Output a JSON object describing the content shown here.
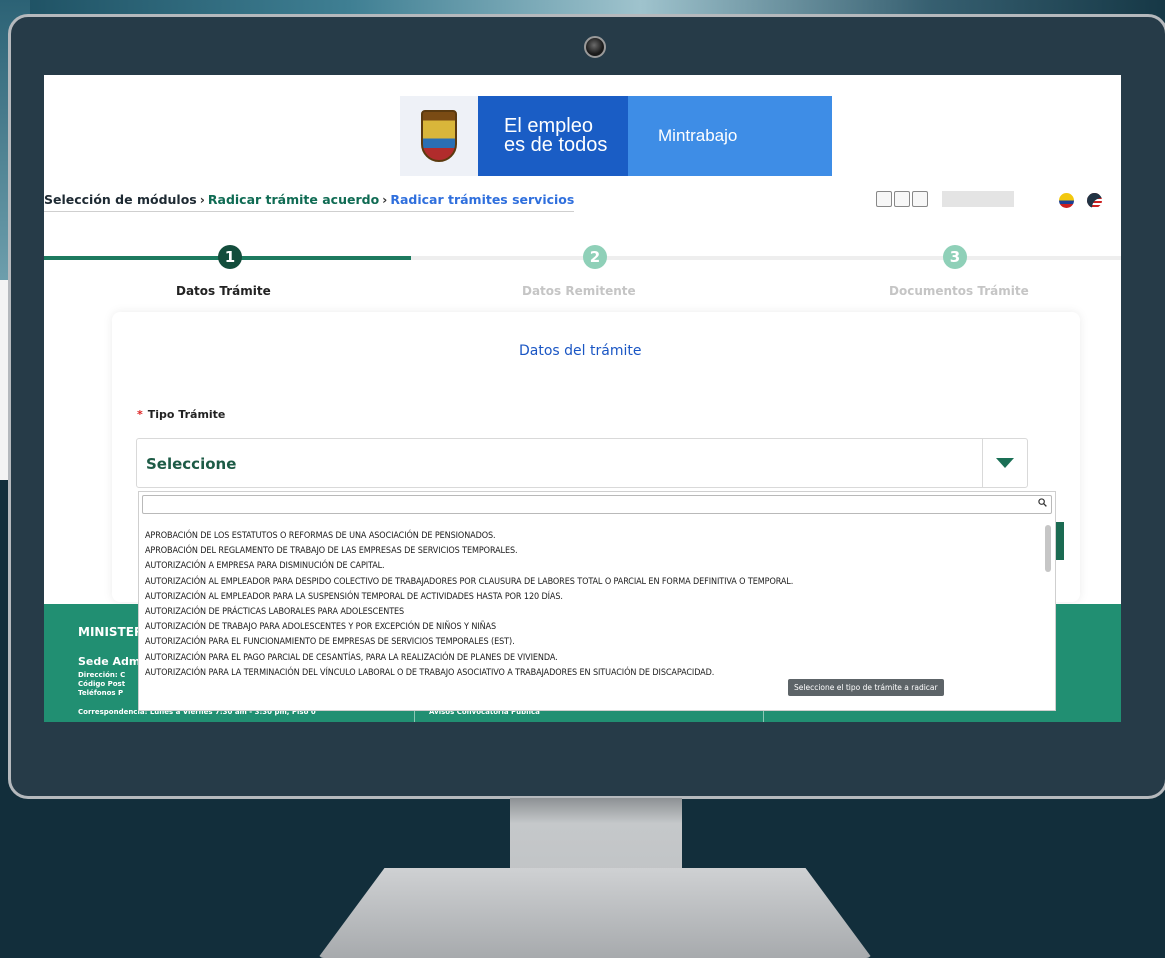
{
  "header": {
    "slogan_line1": "El empleo",
    "slogan_line2": "es de todos",
    "brand": "Mintrabajo"
  },
  "breadcrumb": {
    "item1": "Selección de módulos",
    "item2": "Radicar trámite acuerdo",
    "item3": "Radicar trámites servicios",
    "separator": "›"
  },
  "stepper": {
    "steps": [
      {
        "number": "1",
        "label": "Datos Trámite",
        "state": "active"
      },
      {
        "number": "2",
        "label": "Datos Remitente",
        "state": "pending"
      },
      {
        "number": "3",
        "label": "Documentos Trámite",
        "state": "pending"
      }
    ]
  },
  "form": {
    "title": "Datos del trámite",
    "required_mark": "*",
    "field_label": "Tipo Trámite",
    "select_value": "Seleccione",
    "search_value": ""
  },
  "dropdown": {
    "options": [
      "APROBACIÓN DE LOS ESTATUTOS O REFORMAS DE UNA ASOCIACIÓN DE PENSIONADOS.",
      "APROBACIÓN DEL REGLAMENTO DE TRABAJO DE LAS EMPRESAS DE SERVICIOS TEMPORALES.",
      "AUTORIZACIÓN A EMPRESA PARA DISMINUCIÓN DE CAPITAL.",
      "AUTORIZACIÓN AL EMPLEADOR PARA DESPIDO COLECTIVO DE TRABAJADORES POR CLAUSURA DE LABORES TOTAL O PARCIAL EN FORMA DEFINITIVA O TEMPORAL.",
      "AUTORIZACIÓN AL EMPLEADOR PARA LA SUSPENSIÓN TEMPORAL DE ACTIVIDADES HASTA POR 120 DÍAS.",
      "AUTORIZACIÓN DE PRÁCTICAS LABORALES PARA ADOLESCENTES",
      "AUTORIZACIÓN DE TRABAJO PARA ADOLESCENTES Y POR EXCEPCIÓN DE NIÑOS Y NIÑAS",
      "AUTORIZACIÓN PARA EL FUNCIONAMIENTO DE EMPRESAS DE SERVICIOS TEMPORALES (EST).",
      "AUTORIZACIÓN PARA EL PAGO PARCIAL DE CESANTÍAS, PARA LA REALIZACIÓN DE PLANES DE VIVIENDA.",
      "AUTORIZACIÓN PARA LA TERMINACIÓN DEL VÍNCULO LABORAL O DE TRABAJO ASOCIATIVO A TRABAJADORES EN SITUACIÓN DE DISCAPACIDAD."
    ]
  },
  "tooltip": "Seleccione el tipo de trámite a radicar",
  "footer": {
    "ministry": "MINISTER",
    "sede": "Sede Adm",
    "lines": [
      "Dirección: C",
      "Código Post",
      "Teléfonos P",
      "Correspondencia: Lunes a Viernes 7:30 am - 3:30 pm, Piso 0"
    ],
    "right_text": "Avisos Convocatoria Pública"
  },
  "colors": {
    "primary_green": "#1d7a5f",
    "link_blue": "#2f6fdd",
    "banner_dark_blue": "#1a5dc5",
    "banner_light_blue": "#3e8de6",
    "footer_green": "#218f72"
  }
}
